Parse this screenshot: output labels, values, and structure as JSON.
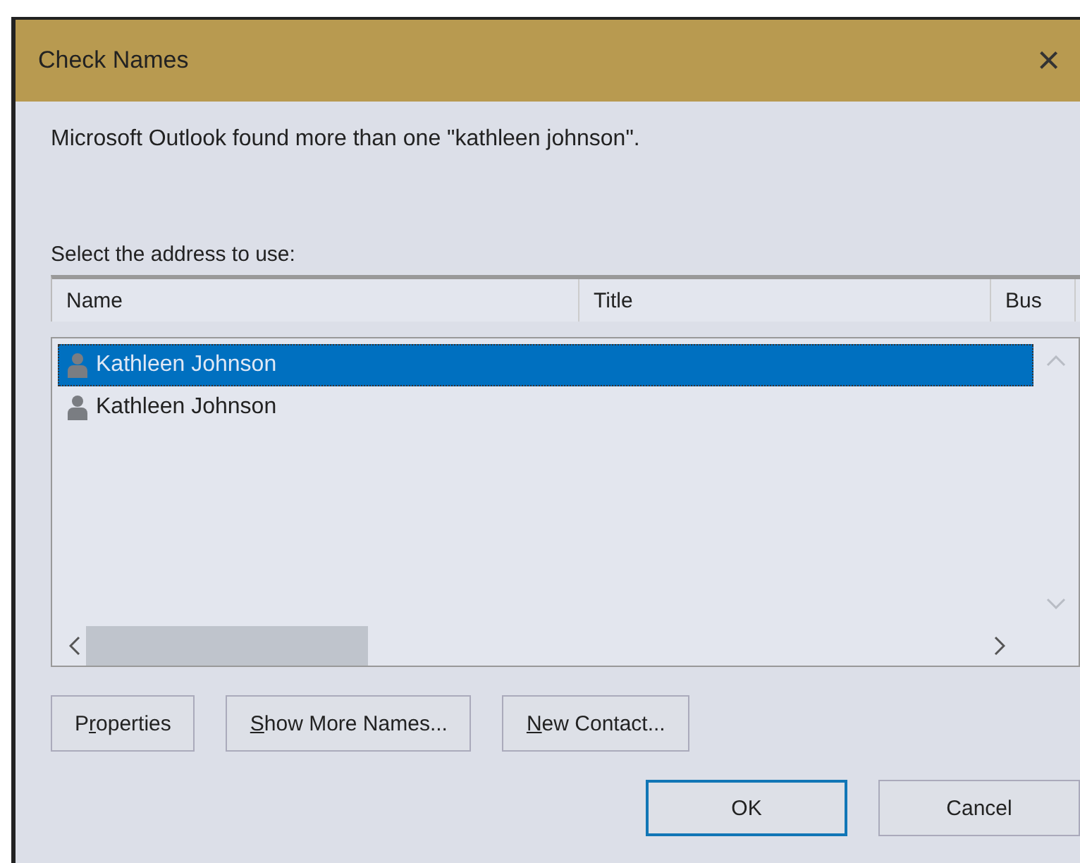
{
  "window": {
    "title": "Check Names",
    "close": "×"
  },
  "message": "Microsoft Outlook found more than one \"kathleen johnson\".",
  "prompt": "Select the address to use:",
  "table": {
    "columns": [
      "Name",
      "Title",
      "Bus"
    ],
    "rows": [
      {
        "name": "Kathleen Johnson",
        "selected": true
      },
      {
        "name": "Kathleen Johnson",
        "selected": false
      }
    ]
  },
  "buttons": [
    {
      "label_start": "P",
      "access_key": "r",
      "label_end": "operties"
    },
    {
      "access_key": "S",
      "label_end": "how More Names..."
    },
    {
      "access_key": "N",
      "label_end": "ew Contact..."
    }
  ],
  "dialog_buttons": [
    {
      "label": "OK",
      "default": true
    },
    {
      "label": "Cancel",
      "default": false
    }
  ]
}
